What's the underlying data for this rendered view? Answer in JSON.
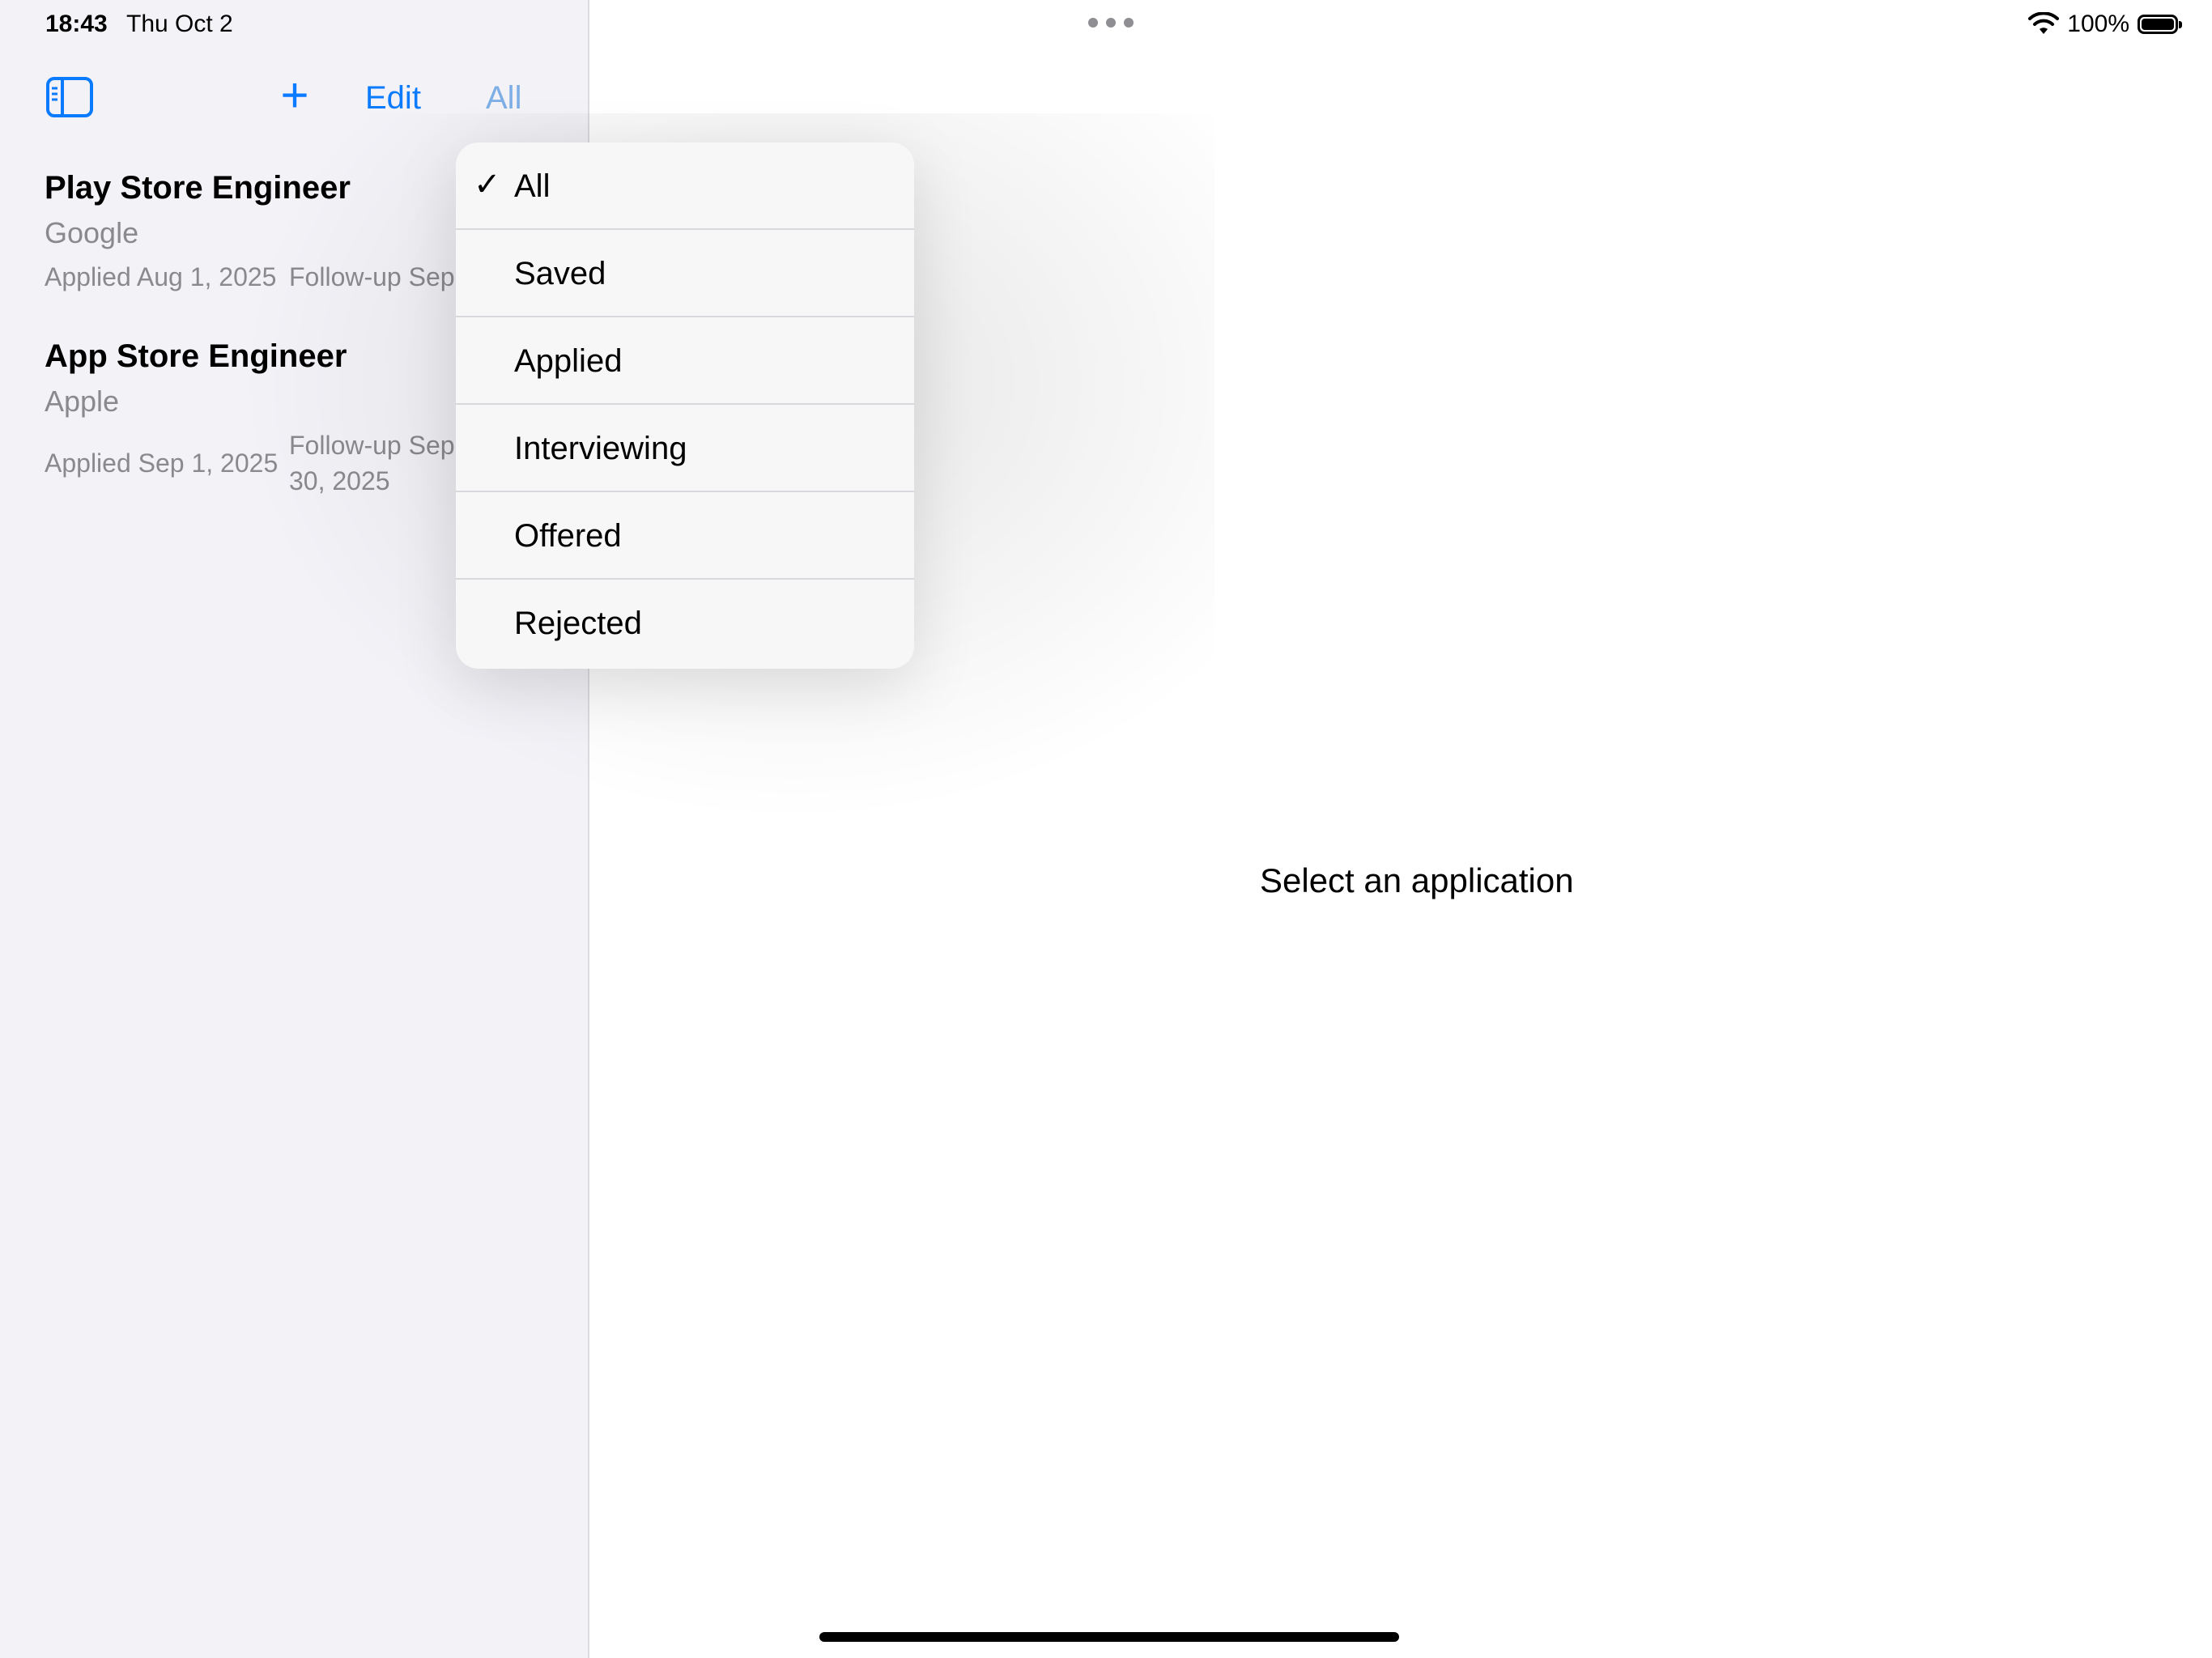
{
  "status_bar": {
    "time": "18:43",
    "date": "Thu Oct 2",
    "battery_text": "100%",
    "battery_level": 1.0
  },
  "toolbar": {
    "sidebar_toggle_icon": "sidebar-left-icon",
    "add_icon": "plus-icon",
    "add_glyph": "+",
    "edit_label": "Edit",
    "filter_label": "All"
  },
  "applications": [
    {
      "title": "Play Store Engineer",
      "company": "Google",
      "applied": "Applied Aug 1, 2025",
      "followup": "Follow-up Sep"
    },
    {
      "title": "App Store Engineer",
      "company": "Apple",
      "applied": "Applied Sep 1, 2025",
      "followup": "Follow-up Sep 30, 2025"
    }
  ],
  "filter_menu": {
    "check_glyph": "✓",
    "items": [
      "All",
      "Saved",
      "Applied",
      "Interviewing",
      "Offered",
      "Rejected"
    ],
    "selected": "All"
  },
  "detail": {
    "placeholder": "Select an application"
  },
  "colors": {
    "accent": "#0a7aff",
    "sidebar_bg": "#f2f2f7",
    "secondary_text": "#8a8a8e"
  }
}
